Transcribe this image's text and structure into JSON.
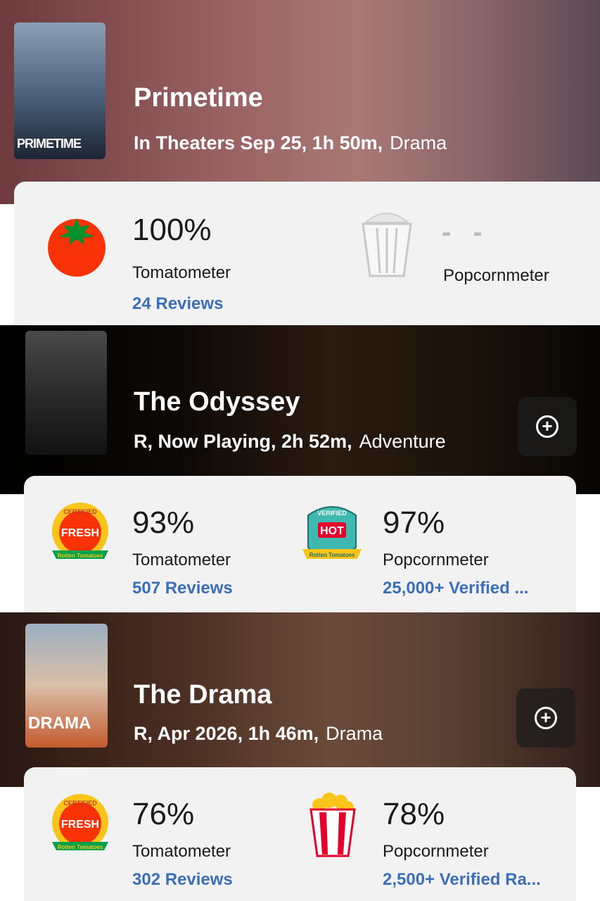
{
  "movies": [
    {
      "title": "Primetime",
      "info": "In Theaters Sep 25, 1h 50m,",
      "genre": "Drama",
      "poster_text": "PRIMETIME",
      "tomatometer": {
        "score": "100%",
        "label": "Tomatometer",
        "reviews": "24 Reviews",
        "icon": "fresh-tomato-icon"
      },
      "popcornmeter": {
        "score": "- -",
        "label": "Popcornmeter",
        "icon": "empty-popcorn-bucket-icon"
      }
    },
    {
      "title": "The Odyssey",
      "info": "R, Now Playing, 2h 52m,",
      "genre": "Adventure",
      "tomatometer": {
        "score": "93%",
        "label": "Tomatometer",
        "reviews": "507 Reviews",
        "icon": "certified-fresh-icon",
        "badge_top": "CERTIFIED",
        "badge_main": "FRESH",
        "badge_sub": "Rotten Tomatoes"
      },
      "popcornmeter": {
        "score": "97%",
        "label": "Popcornmeter",
        "reviews": "25,000+ Verified ...",
        "icon": "verified-hot-icon",
        "badge_top": "VERIFIED",
        "badge_main": "HOT",
        "badge_sub": "Rotten Tomatoes"
      }
    },
    {
      "title": "The Drama",
      "info": "R, Apr 2026, 1h 46m,",
      "genre": "Drama",
      "poster_text": "DRAMA",
      "tomatometer": {
        "score": "76%",
        "label": "Tomatometer",
        "reviews": "302 Reviews",
        "icon": "certified-fresh-icon",
        "badge_top": "CERTIFIED",
        "badge_main": "FRESH",
        "badge_sub": "Rotten Tomatoes"
      },
      "popcornmeter": {
        "score": "78%",
        "label": "Popcornmeter",
        "reviews": "2,500+ Verified Ra...",
        "icon": "full-popcorn-bucket-icon"
      }
    }
  ],
  "colors": {
    "tomato_red": "#f93208",
    "link_blue": "#3b6fb8",
    "card_bg": "#f2f2f2",
    "badge_green": "#00a14b",
    "badge_yellow": "#f9c51b"
  }
}
